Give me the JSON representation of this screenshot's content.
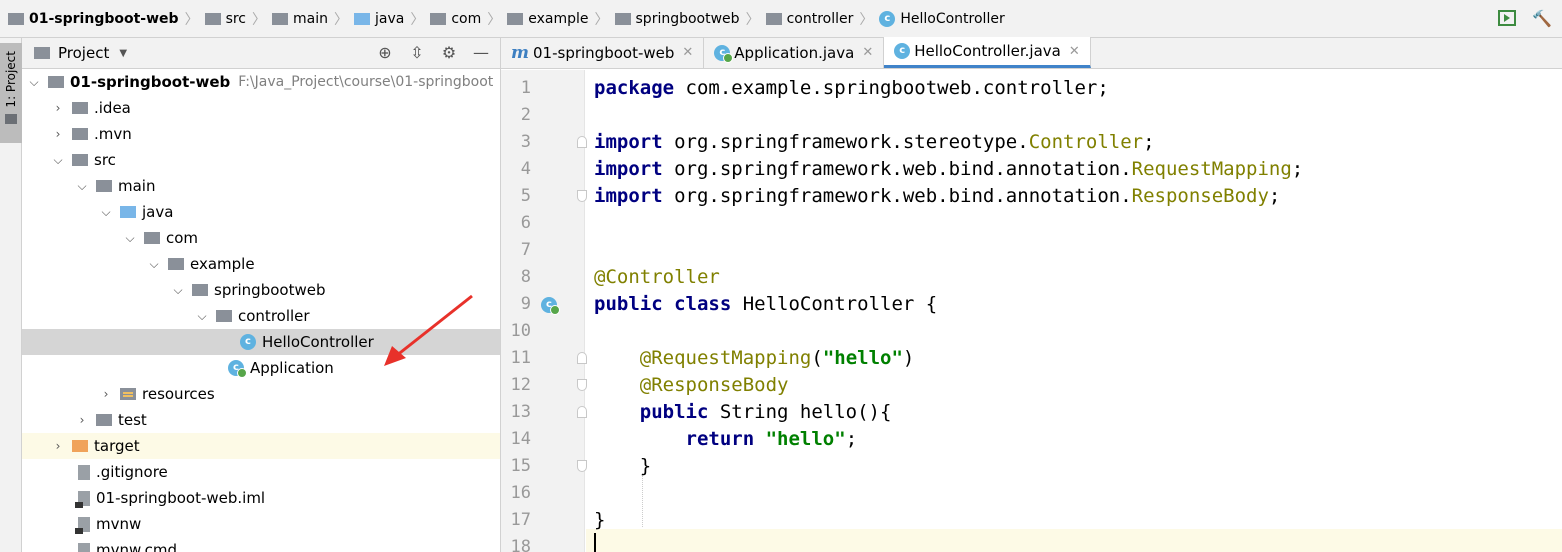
{
  "breadcrumb": {
    "items": [
      {
        "label": "01-springboot-web",
        "icon": "project-module-icon"
      },
      {
        "label": "src",
        "icon": "folder-icon"
      },
      {
        "label": "main",
        "icon": "folder-icon"
      },
      {
        "label": "java",
        "icon": "source-folder-icon"
      },
      {
        "label": "com",
        "icon": "package-icon"
      },
      {
        "label": "example",
        "icon": "package-icon"
      },
      {
        "label": "springbootweb",
        "icon": "package-icon"
      },
      {
        "label": "controller",
        "icon": "package-icon"
      },
      {
        "label": "HelloController",
        "icon": "class-icon"
      }
    ]
  },
  "side_strip": {
    "project_tab": "1: Project"
  },
  "project_pane": {
    "title": "Project",
    "tree": [
      {
        "label": "01-springboot-web",
        "path": "F:\\Java_Project\\course\\01-springboot",
        "level": 0,
        "expanded": true,
        "icon": "module"
      },
      {
        "label": ".idea",
        "level": 1,
        "expanded": false,
        "icon": "folder"
      },
      {
        "label": ".mvn",
        "level": 1,
        "expanded": false,
        "icon": "folder"
      },
      {
        "label": "src",
        "level": 1,
        "expanded": true,
        "icon": "folder"
      },
      {
        "label": "main",
        "level": 2,
        "expanded": true,
        "icon": "folder"
      },
      {
        "label": "java",
        "level": 3,
        "expanded": true,
        "icon": "source-folder"
      },
      {
        "label": "com",
        "level": 4,
        "expanded": true,
        "icon": "package"
      },
      {
        "label": "example",
        "level": 5,
        "expanded": true,
        "icon": "package"
      },
      {
        "label": "springbootweb",
        "level": 6,
        "expanded": true,
        "icon": "package"
      },
      {
        "label": "controller",
        "level": 7,
        "expanded": true,
        "icon": "package"
      },
      {
        "label": "HelloController",
        "level": 8,
        "icon": "class",
        "selected": true
      },
      {
        "label": "Application",
        "level": 8,
        "icon": "app-class"
      },
      {
        "label": "resources",
        "level": 3,
        "expanded": false,
        "icon": "resources-folder"
      },
      {
        "label": "test",
        "level": 2,
        "expanded": false,
        "icon": "folder"
      },
      {
        "label": "target",
        "level": 1,
        "expanded": false,
        "icon": "excluded-folder",
        "highlight": true
      },
      {
        "label": ".gitignore",
        "level": 1,
        "icon": "file"
      },
      {
        "label": "01-springboot-web.iml",
        "level": 1,
        "icon": "iml-file"
      },
      {
        "label": "mvnw",
        "level": 1,
        "icon": "script-file"
      },
      {
        "label": "mvnw.cmd",
        "level": 1,
        "icon": "script-file"
      }
    ]
  },
  "editor": {
    "tabs": [
      {
        "label": "01-springboot-web",
        "icon": "maven-icon",
        "active": false
      },
      {
        "label": "Application.java",
        "icon": "app-class-icon",
        "active": false
      },
      {
        "label": "HelloController.java",
        "icon": "class-icon",
        "active": true
      }
    ],
    "line_numbers": [
      "1",
      "2",
      "3",
      "4",
      "5",
      "6",
      "7",
      "8",
      "9",
      "10",
      "11",
      "12",
      "13",
      "14",
      "15",
      "16",
      "17",
      "18"
    ],
    "code": {
      "l1_kw": "package",
      "l1_rest": " com.example.springbootweb.controller;",
      "l3_kw": "import",
      "l3_pkg": " org.springframework.stereotype.",
      "l3_cls": "Controller",
      "l3_end": ";",
      "l4_kw": "import",
      "l4_pkg": " org.springframework.web.bind.annotation.",
      "l4_cls": "RequestMapping",
      "l4_end": ";",
      "l5_kw": "import",
      "l5_pkg": " org.springframework.web.bind.annotation.",
      "l5_cls": "ResponseBody",
      "l5_end": ";",
      "l8_ann": "@Controller",
      "l9_kw1": "public",
      "l9_kw2": "class",
      "l9_rest": " HelloController {",
      "l11_ann": "@RequestMapping",
      "l11_open": "(",
      "l11_str": "\"hello\"",
      "l11_close": ")",
      "l12_ann": "@ResponseBody",
      "l13_kw": "public",
      "l13_rest": " String hello(){",
      "l14_kw": "return",
      "l14_str": "\"hello\"",
      "l14_end": ";",
      "l15": "}",
      "l17": "}"
    }
  },
  "colors": {
    "keyword": "#000080",
    "annotation": "#808000",
    "string": "#008000",
    "selection": "#d5d5d5",
    "arrow": "#e8312a"
  }
}
